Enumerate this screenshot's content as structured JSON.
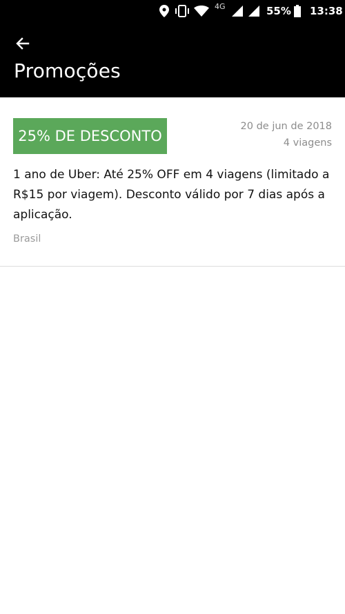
{
  "status_bar": {
    "network": "4G",
    "battery": "55%",
    "time": "13:38",
    "icons": [
      "location-icon",
      "vibrate-icon",
      "wifi-icon",
      "signal-icon",
      "signal-icon",
      "battery-icon"
    ]
  },
  "header": {
    "title": "Promoções",
    "back_icon": "arrow-left-icon"
  },
  "promotion": {
    "badge": "25% DE DESCONTO",
    "date": "20 de jun de 2018",
    "trips": "4 viagens",
    "description": "1 ano de Uber: Até 25% OFF em 4 viagens (limitado a R$15 por viagem). Desconto válido por 7 dias após a aplicação.",
    "country": "Brasil"
  },
  "colors": {
    "header_bg": "#000000",
    "badge_bg": "#5ba85a",
    "secondary_text": "#8c8c8c"
  }
}
